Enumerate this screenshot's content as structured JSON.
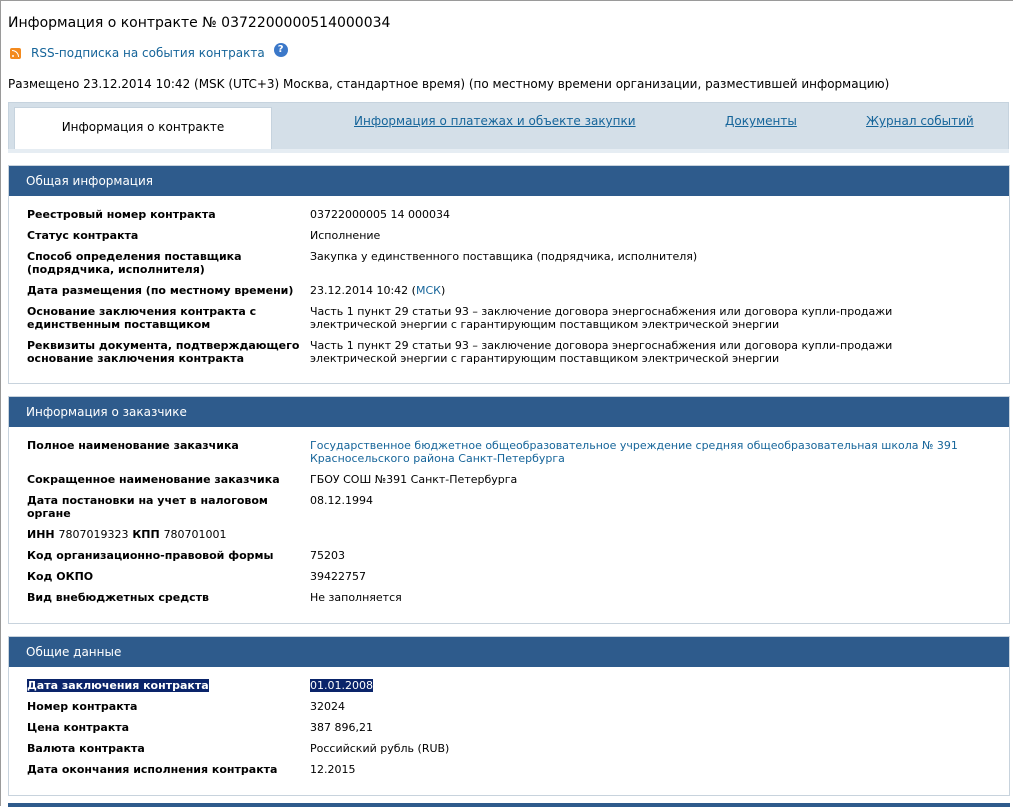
{
  "page": {
    "title": "Информация о контракте № 0372200000514000034",
    "rss_label": "RSS-подписка на события контракта",
    "help_label": "?",
    "posted": "Размещено 23.12.2014 10:42 (MSK (UTC+3) Москва, стандартное время) (по местному времени организации, разместившей информацию)"
  },
  "tabs": [
    {
      "label": "Информация о контракте"
    },
    {
      "label": "Информация о платежах и объекте закупки"
    },
    {
      "label": "Документы"
    },
    {
      "label": "Журнал событий"
    }
  ],
  "general": {
    "heading": "Общая информация",
    "rows": [
      {
        "label": "Реестровый номер контракта",
        "value": "03722000005 14 000034"
      },
      {
        "label": "Статус контракта",
        "value": "Исполнение"
      },
      {
        "label": "Способ определения поставщика (подрядчика, исполнителя)",
        "value": "Закупка у единственного поставщика (подрядчика, исполнителя)"
      },
      {
        "label": "Дата размещения (по местному времени)",
        "value": "23.12.2014 10:42 (",
        "value_link": "МСК",
        "value_suffix": ")"
      },
      {
        "label": "Основание заключения контракта с единственным поставщиком",
        "value": "Часть 1 пункт 29 статьи 93 – заключение договора энергоснабжения или договора купли-продажи электрической энергии с гарантирующим поставщиком электрической энергии"
      },
      {
        "label": "Реквизиты документа, подтверждающего основание заключения контракта",
        "value": "Часть 1 пункт 29 статьи 93 – заключение договора энергоснабжения или договора купли-продажи электрической энергии с гарантирующим поставщиком электрической энергии"
      }
    ]
  },
  "customer": {
    "heading": "Информация о заказчике",
    "rows": [
      {
        "label": "Полное наименование заказчика",
        "value": "Государственное бюджетное общеобразовательное учреждение средняя общеобразовательная школа № 391 Красносельского района Санкт-Петербурга"
      },
      {
        "label": "Сокращенное наименование заказчика",
        "value": "ГБОУ СОШ №391 Санкт-Петербурга"
      },
      {
        "label": "Дата постановки на учет в налоговом органе",
        "value": "08.12.1994"
      },
      {
        "inn_label": "ИНН",
        "inn_value": "7807019323",
        "kpp_label": "КПП",
        "kpp_value": "780701001"
      },
      {
        "label": "Код организационно-правовой формы",
        "value": "75203"
      },
      {
        "label": "Код ОКПО",
        "value": "39422757"
      },
      {
        "label": "Вид внебюджетных средств",
        "value": "Не заполняется"
      }
    ]
  },
  "common": {
    "heading": "Общие данные",
    "rows": [
      {
        "label": "Дата заключения контракта",
        "value": "01.01.2008"
      },
      {
        "label": "Номер контракта",
        "value": "32024"
      },
      {
        "label": "Цена контракта",
        "value": "387 896,21"
      },
      {
        "label": "Валюта контракта",
        "value": "Российский рубль (RUB)"
      },
      {
        "label": "Дата окончания исполнения контракта",
        "value": "12.2015"
      }
    ]
  }
}
